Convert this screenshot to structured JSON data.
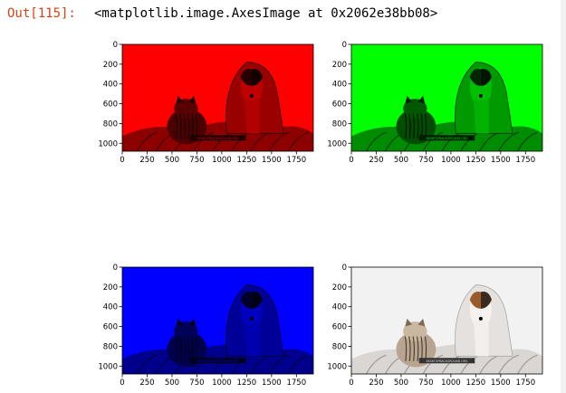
{
  "cell": {
    "prompt": "Out[115]:",
    "repr": "<matplotlib.image.AxesImage at 0x2062e38bb08>"
  },
  "chart_data": [
    {
      "type": "image",
      "channel": "red",
      "tint": "#ff0000",
      "xlim": [
        0,
        1920
      ],
      "ylim": [
        1080,
        0
      ],
      "x_ticks": [
        "0",
        "250",
        "500",
        "750",
        "1000",
        "1250",
        "1500",
        "1750"
      ],
      "y_ticks": [
        "0",
        "200",
        "400",
        "600",
        "800",
        "1000"
      ],
      "watermark": "DESKTOPBACKGROUND.ORG",
      "grid": false
    },
    {
      "type": "image",
      "channel": "green",
      "tint": "#00ff00",
      "xlim": [
        0,
        1920
      ],
      "ylim": [
        1080,
        0
      ],
      "x_ticks": [
        "0",
        "250",
        "500",
        "750",
        "1000",
        "1250",
        "1500",
        "1750"
      ],
      "y_ticks": [
        "0",
        "200",
        "400",
        "600",
        "800",
        "1000"
      ],
      "watermark": "DESKTOPBACKGROUND.ORG",
      "grid": false
    },
    {
      "type": "image",
      "channel": "blue",
      "tint": "#0000ff",
      "xlim": [
        0,
        1920
      ],
      "ylim": [
        1080,
        0
      ],
      "x_ticks": [
        "0",
        "250",
        "500",
        "750",
        "1000",
        "1250",
        "1500",
        "1750"
      ],
      "y_ticks": [
        "0",
        "200",
        "400",
        "600",
        "800",
        "1000"
      ],
      "watermark": "DESKTOPBACKGROUND.ORG",
      "grid": false
    },
    {
      "type": "image",
      "channel": "rgb",
      "tint": "#eeeeee",
      "xlim": [
        0,
        1920
      ],
      "ylim": [
        1080,
        0
      ],
      "x_ticks": [
        "0",
        "250",
        "500",
        "750",
        "1000",
        "1250",
        "1500",
        "1750"
      ],
      "y_ticks": [
        "0",
        "200",
        "400",
        "600",
        "800",
        "1000"
      ],
      "watermark": "DESKTOPBACKGROUND.ORG",
      "grid": false
    }
  ]
}
